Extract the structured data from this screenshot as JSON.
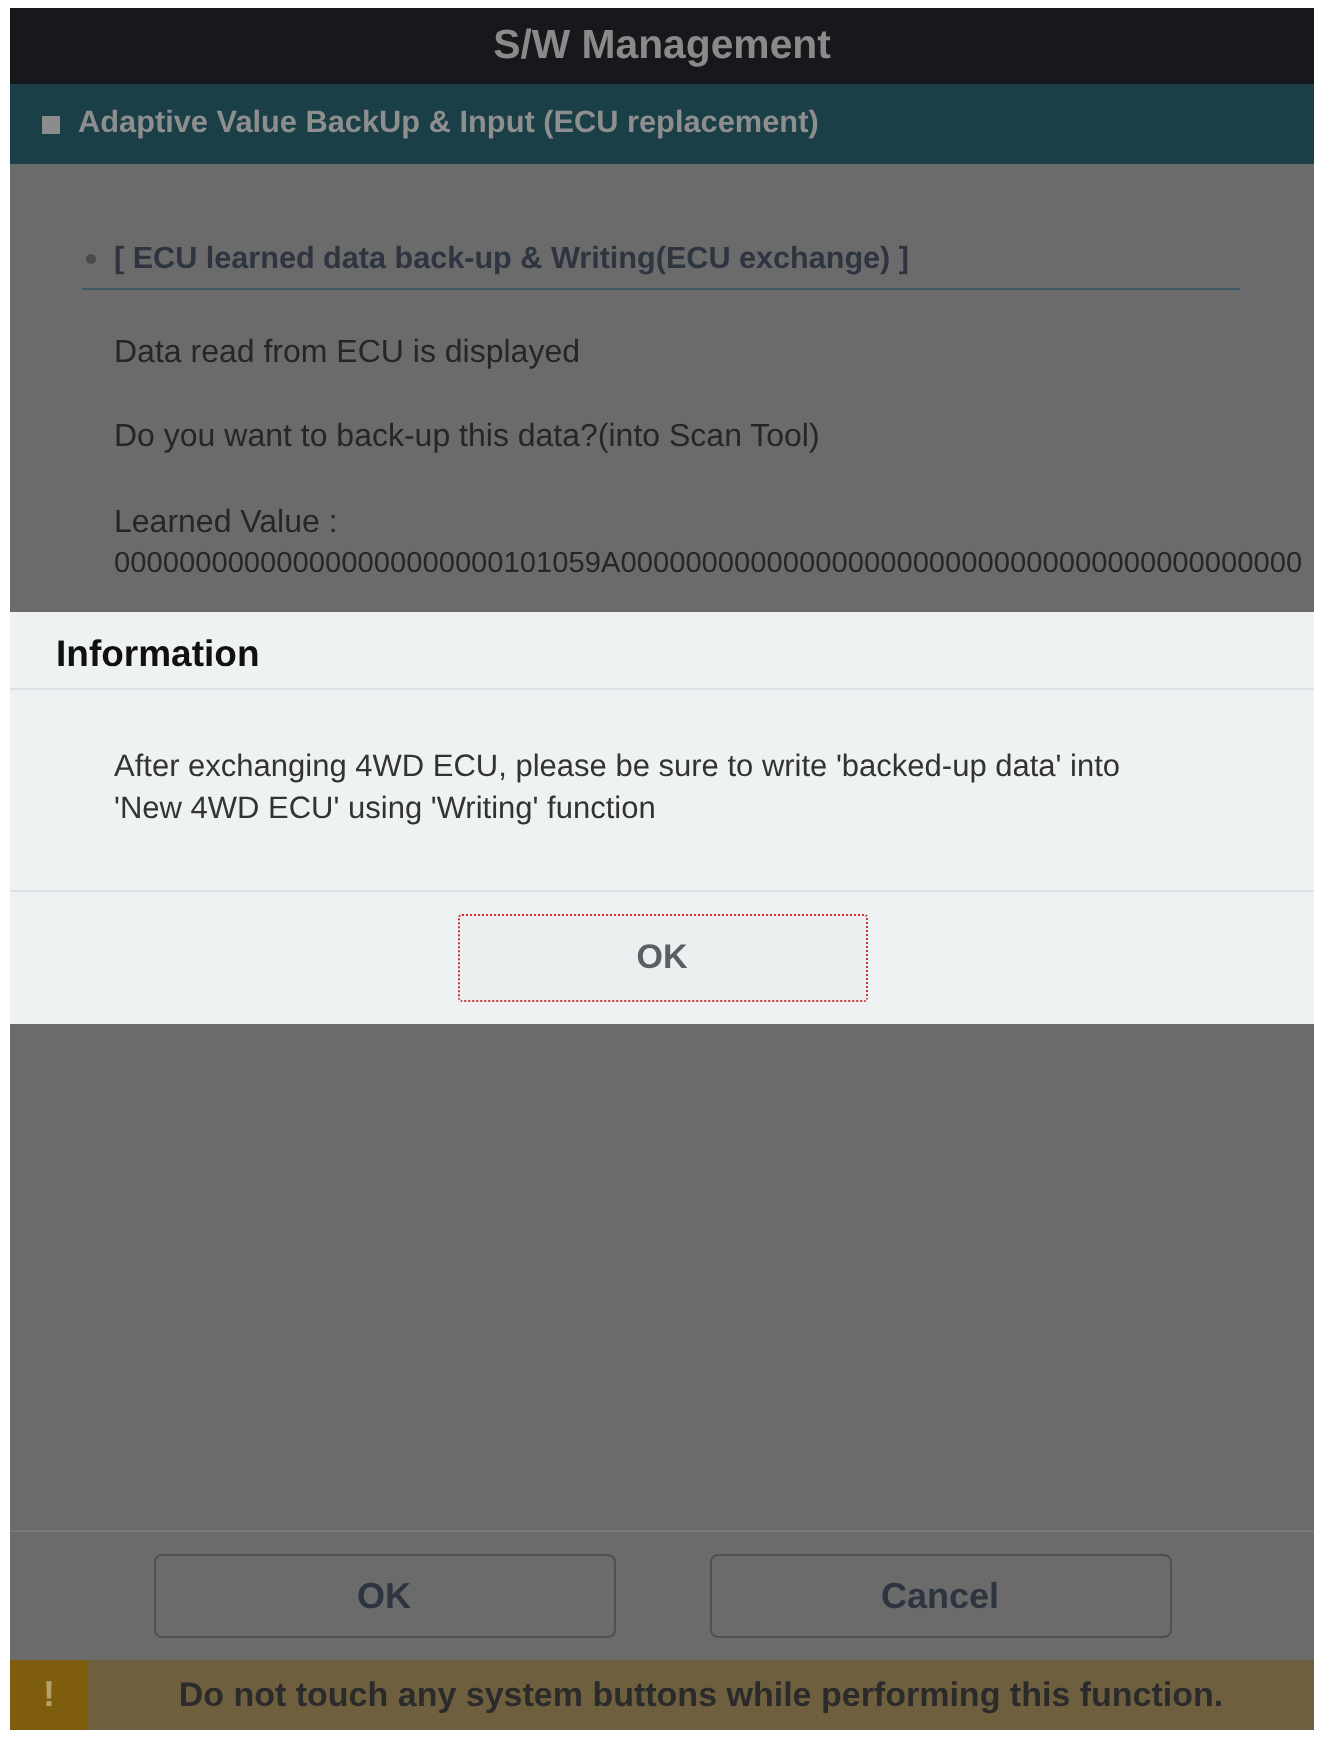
{
  "window": {
    "title": "S/W Management"
  },
  "section_header": {
    "title": "Adaptive Value BackUp & Input (ECU replacement)"
  },
  "content": {
    "heading": "[ ECU learned data back-up & Writing(ECU exchange) ]",
    "lines": [
      "Data read from ECU is displayed",
      "Do you want to back-up this data?(into Scan Tool)"
    ],
    "learned_value": {
      "label": "Learned Value :",
      "value": "000000000000000000000000101059A000000000000000000000000000000000000000000"
    }
  },
  "dialog": {
    "title": "Information",
    "message": "After exchanging 4WD ECU, please be sure to write 'backed-up data' into 'New 4WD ECU' using 'Writing' function",
    "ok_button": {
      "label": "OK",
      "focused": true
    }
  },
  "footer": {
    "ok_button": "OK",
    "cancel_button": "Cancel"
  },
  "warning_bar": {
    "icon": "!",
    "message": "Do not touch any system buttons while performing this function."
  }
}
